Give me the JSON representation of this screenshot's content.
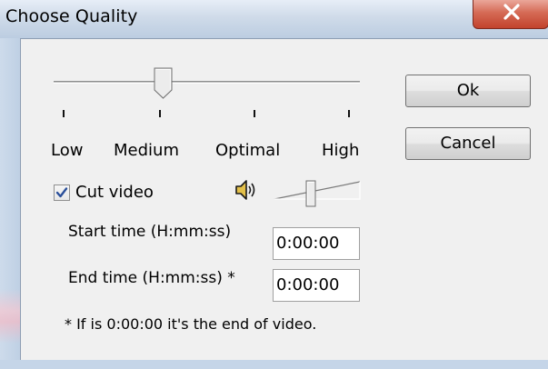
{
  "window": {
    "title": "Choose Quality"
  },
  "quality": {
    "labels": [
      "Low",
      "Medium",
      "Optimal",
      "High"
    ],
    "selected": "Medium"
  },
  "buttons": {
    "ok_label": "Ok",
    "cancel_label": "Cancel"
  },
  "cut_video": {
    "label": "Cut video",
    "checked": true
  },
  "volume": {
    "icon": "speaker-icon",
    "level": 0.45
  },
  "start_time": {
    "label": "Start time (H:mm:ss)",
    "value": "0:00:00"
  },
  "end_time": {
    "label": "End time (H:mm:ss) *",
    "value": "0:00:00"
  },
  "footnote": "* If is 0:00:00 it's the end of video.",
  "colors": {
    "close_button": "#c8482f",
    "check_mark": "#2a4f9a"
  }
}
